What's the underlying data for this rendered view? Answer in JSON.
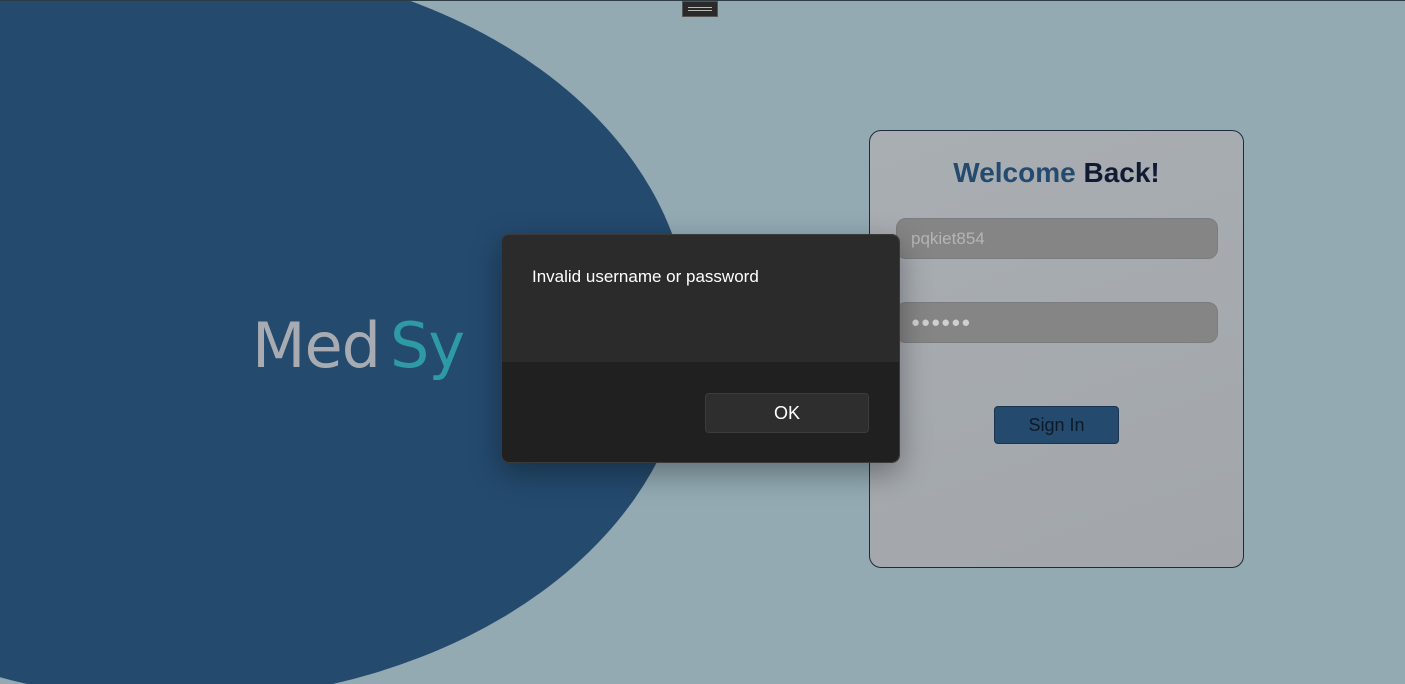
{
  "logo": {
    "part_a": "Med",
    "part_b": "Sy"
  },
  "login": {
    "title_part1": "Welcome",
    "title_part2": "Back!",
    "username_value": "pqkiet854",
    "password_value": "●●●●●●",
    "signin_label": "Sign In"
  },
  "dialog": {
    "message": "Invalid username or password",
    "ok_label": "OK"
  },
  "colors": {
    "background": "#93aab3",
    "primary_navy": "#244a6e",
    "teal_accent": "#2e9aa3",
    "dialog_bg": "#2b2b2b"
  }
}
